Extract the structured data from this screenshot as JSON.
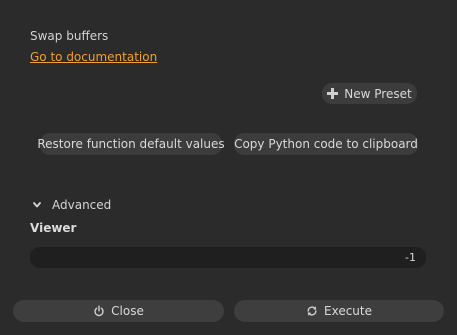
{
  "operator": {
    "description": "Swap buffers",
    "doc_link": "Go to documentation"
  },
  "presets": {
    "new_preset_label": "New Preset"
  },
  "actions": {
    "restore_label": "Restore function default values",
    "copy_label": "Copy Python code to clipboard"
  },
  "advanced": {
    "label": "Advanced",
    "expanded": true
  },
  "fields": {
    "viewer": {
      "label": "Viewer",
      "value": "-1"
    }
  },
  "footer": {
    "close_label": "Close",
    "execute_label": "Execute"
  },
  "colors": {
    "background": "#2b2b2b",
    "link": "#f0a030",
    "button": "#3c3c3c",
    "input": "#1f1f1f"
  },
  "icons": {
    "new_preset": "plus-icon",
    "advanced": "chevron-down-icon",
    "close": "power-icon",
    "execute": "refresh-icon"
  }
}
